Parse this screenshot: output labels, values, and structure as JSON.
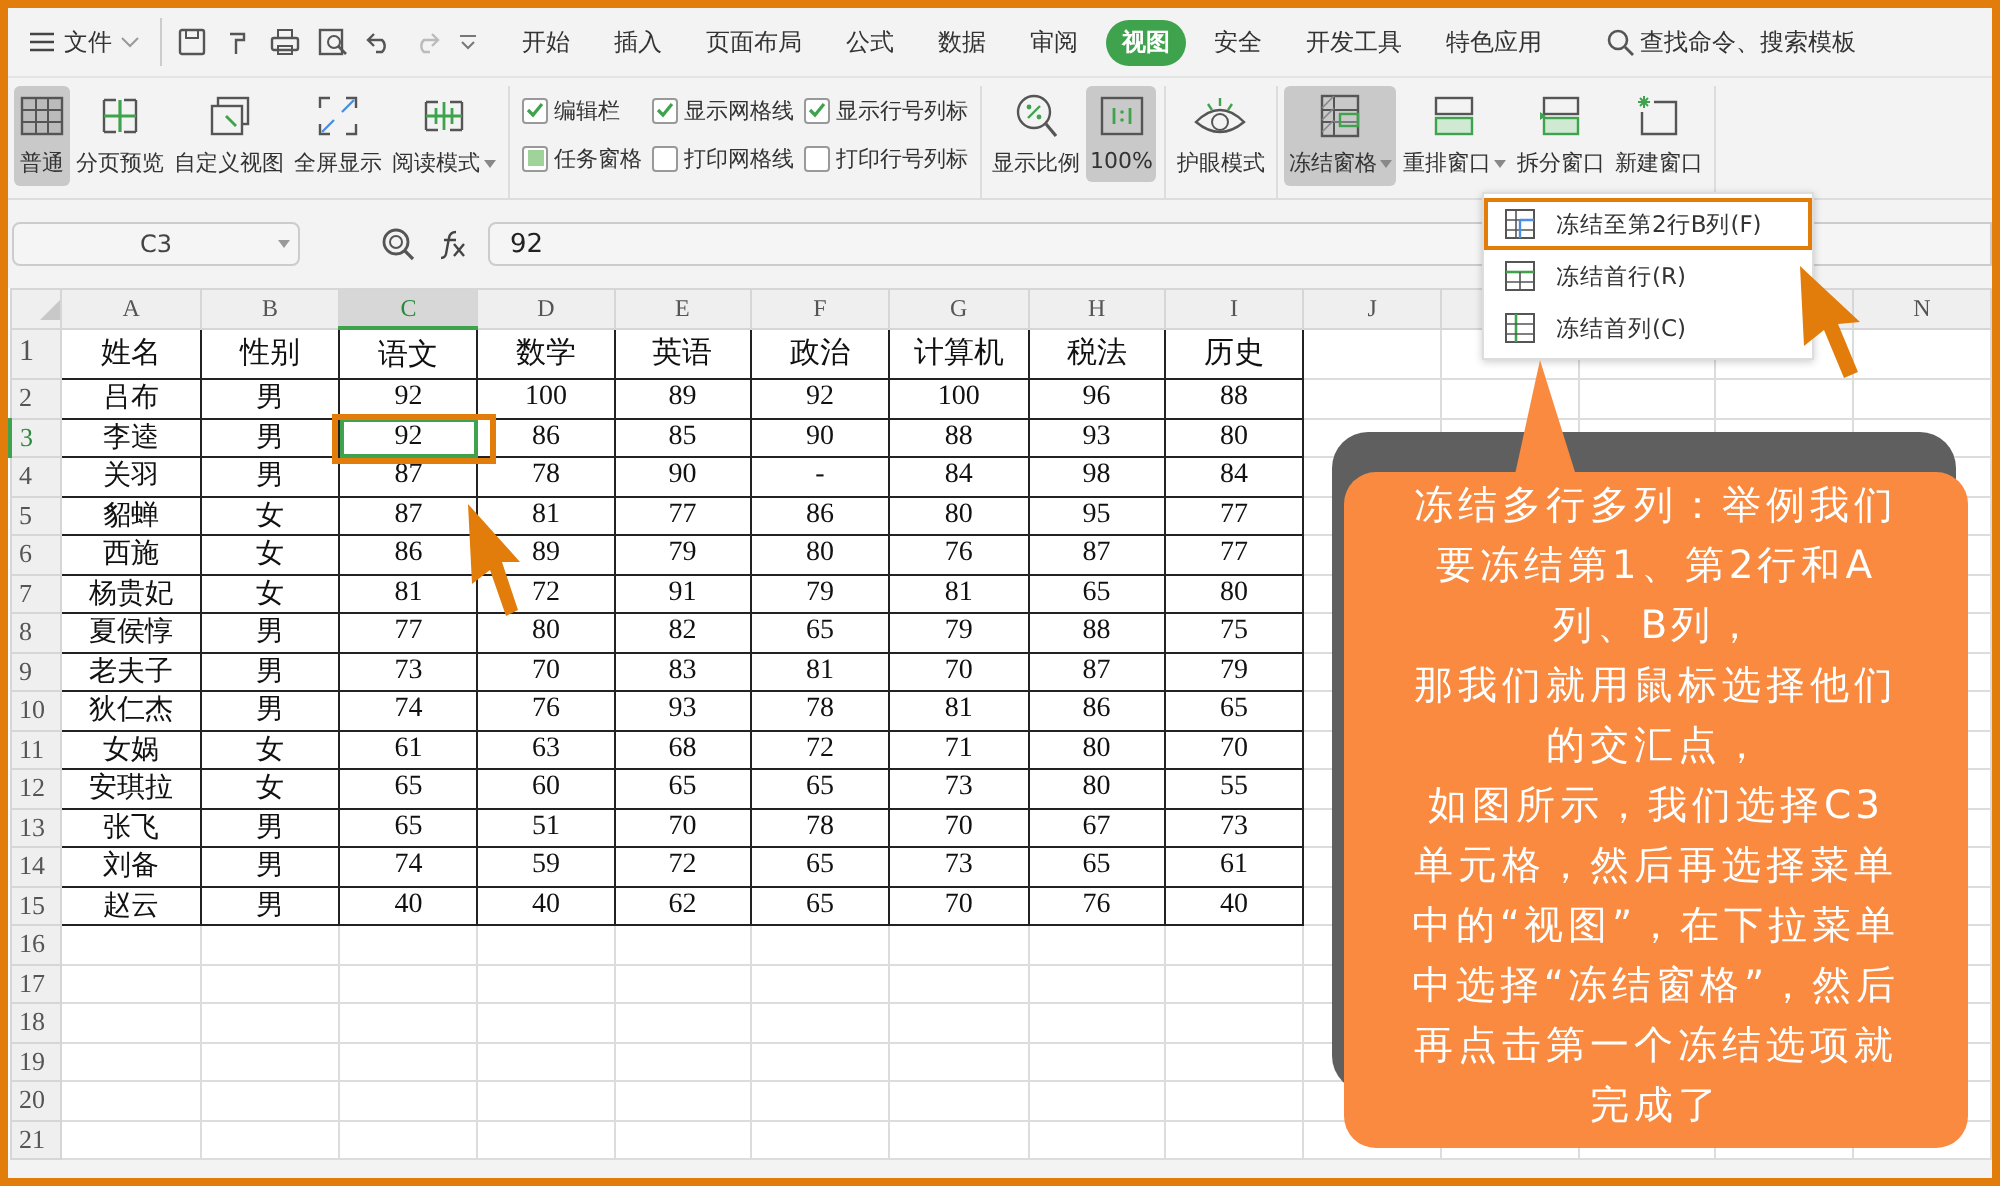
{
  "menu": {
    "file": "文件"
  },
  "tabs": [
    {
      "label": "开始",
      "selected": false
    },
    {
      "label": "插入",
      "selected": false
    },
    {
      "label": "页面布局",
      "selected": false
    },
    {
      "label": "公式",
      "selected": false
    },
    {
      "label": "数据",
      "selected": false
    },
    {
      "label": "审阅",
      "selected": false
    },
    {
      "label": "视图",
      "selected": true
    },
    {
      "label": "安全",
      "selected": false
    },
    {
      "label": "开发工具",
      "selected": false
    },
    {
      "label": "特色应用",
      "selected": false
    }
  ],
  "search": {
    "label": "查找命令、搜索模板"
  },
  "ribbon": {
    "view_buttons": [
      {
        "label": "普通",
        "selected": true,
        "dropdown": false
      },
      {
        "label": "分页预览",
        "selected": false,
        "dropdown": false
      },
      {
        "label": "自定义视图",
        "selected": false,
        "dropdown": false
      },
      {
        "label": "全屏显示",
        "selected": false,
        "dropdown": false
      },
      {
        "label": "阅读模式",
        "selected": false,
        "dropdown": true
      }
    ],
    "checkboxes": [
      {
        "label": "编辑栏",
        "checked": true,
        "kind": "tick"
      },
      {
        "label": "任务窗格",
        "checked": true,
        "kind": "square"
      },
      {
        "label": "显示网格线",
        "checked": true,
        "kind": "tick"
      },
      {
        "label": "打印网格线",
        "checked": false,
        "kind": "tick"
      },
      {
        "label": "显示行号列标",
        "checked": true,
        "kind": "tick"
      },
      {
        "label": "打印行号列标",
        "checked": false,
        "kind": "tick"
      }
    ],
    "zoom_buttons": [
      {
        "label": "显示比例",
        "selected": false
      },
      {
        "label": "100%",
        "selected": true
      }
    ],
    "eye_button": {
      "label": "护眼模式"
    },
    "window_buttons": [
      {
        "label": "冻结窗格",
        "selected": true,
        "dropdown": true
      },
      {
        "label": "重排窗口",
        "selected": false,
        "dropdown": true
      },
      {
        "label": "拆分窗口",
        "selected": false,
        "dropdown": false
      },
      {
        "label": "新建窗口",
        "selected": false,
        "dropdown": false
      }
    ]
  },
  "formula_bar": {
    "name_box": "C3",
    "formula": "92"
  },
  "sheet": {
    "columns": [
      {
        "label": "A",
        "selected": false
      },
      {
        "label": "B",
        "selected": false
      },
      {
        "label": "C",
        "selected": true
      },
      {
        "label": "D",
        "selected": false
      },
      {
        "label": "E",
        "selected": false
      },
      {
        "label": "F",
        "selected": false
      },
      {
        "label": "G",
        "selected": false
      },
      {
        "label": "H",
        "selected": false
      },
      {
        "label": "I",
        "selected": false
      },
      {
        "label": "J",
        "selected": false
      }
    ],
    "last_column": {
      "label": "N",
      "selected": false
    },
    "rows": [
      {
        "number": "1",
        "selected": false,
        "cells": [
          "姓名",
          "性别",
          "语文",
          "数学",
          "英语",
          "政治",
          "计算机",
          "税法",
          "历史"
        ]
      },
      {
        "number": "2",
        "selected": false,
        "cells": [
          "吕布",
          "男",
          "92",
          "100",
          "89",
          "92",
          "100",
          "96",
          "88"
        ]
      },
      {
        "number": "3",
        "selected": true,
        "cells": [
          "李逵",
          "男",
          "92",
          "86",
          "85",
          "90",
          "88",
          "93",
          "80"
        ]
      },
      {
        "number": "4",
        "selected": false,
        "cells": [
          "关羽",
          "男",
          "87",
          "78",
          "90",
          "-",
          "84",
          "98",
          "84"
        ]
      },
      {
        "number": "5",
        "selected": false,
        "cells": [
          "貂蝉",
          "女",
          "87",
          "81",
          "77",
          "86",
          "80",
          "95",
          "77"
        ]
      },
      {
        "number": "6",
        "selected": false,
        "cells": [
          "西施",
          "女",
          "86",
          "89",
          "79",
          "80",
          "76",
          "87",
          "77"
        ]
      },
      {
        "number": "7",
        "selected": false,
        "cells": [
          "杨贵妃",
          "女",
          "81",
          "72",
          "91",
          "79",
          "81",
          "65",
          "80"
        ]
      },
      {
        "number": "8",
        "selected": false,
        "cells": [
          "夏侯惇",
          "男",
          "77",
          "80",
          "82",
          "65",
          "79",
          "88",
          "75"
        ]
      },
      {
        "number": "9",
        "selected": false,
        "cells": [
          "老夫子",
          "男",
          "73",
          "70",
          "83",
          "81",
          "70",
          "87",
          "79"
        ]
      },
      {
        "number": "10",
        "selected": false,
        "cells": [
          "狄仁杰",
          "男",
          "74",
          "76",
          "93",
          "78",
          "81",
          "86",
          "65"
        ]
      },
      {
        "number": "11",
        "selected": false,
        "cells": [
          "女娲",
          "女",
          "61",
          "63",
          "68",
          "72",
          "71",
          "80",
          "70"
        ]
      },
      {
        "number": "12",
        "selected": false,
        "cells": [
          "安琪拉",
          "女",
          "65",
          "60",
          "65",
          "65",
          "73",
          "80",
          "55"
        ]
      },
      {
        "number": "13",
        "selected": false,
        "cells": [
          "张飞",
          "男",
          "65",
          "51",
          "70",
          "78",
          "70",
          "67",
          "73"
        ]
      },
      {
        "number": "14",
        "selected": false,
        "cells": [
          "刘备",
          "男",
          "74",
          "59",
          "72",
          "65",
          "73",
          "65",
          "61"
        ]
      },
      {
        "number": "15",
        "selected": false,
        "cells": [
          "赵云",
          "男",
          "40",
          "40",
          "62",
          "65",
          "70",
          "76",
          "40"
        ]
      },
      {
        "number": "16",
        "selected": false,
        "cells": []
      },
      {
        "number": "17",
        "selected": false,
        "cells": []
      },
      {
        "number": "18",
        "selected": false,
        "cells": []
      },
      {
        "number": "19",
        "selected": false,
        "cells": []
      },
      {
        "number": "20",
        "selected": false,
        "cells": []
      },
      {
        "number": "21",
        "selected": false,
        "cells": []
      }
    ]
  },
  "freeze_menu": {
    "items": [
      {
        "label": "冻结至第2行B列(F)",
        "highlighted": true
      },
      {
        "label": "冻结首行(R)",
        "highlighted": false
      },
      {
        "label": "冻结首列(C)",
        "highlighted": false
      }
    ]
  },
  "callout": {
    "paragraphs": [
      "冻结多行多列：举例我们要冻结第1、第2行和A列、B列，",
      "那我们就用鼠标选择他们的交汇点，",
      "如图所示，我们选择C3单元格，然后再选择菜单中的“视图”，在下拉菜单中选择“冻结窗格”，然后再点击第一个冻结选项就完成了"
    ]
  }
}
